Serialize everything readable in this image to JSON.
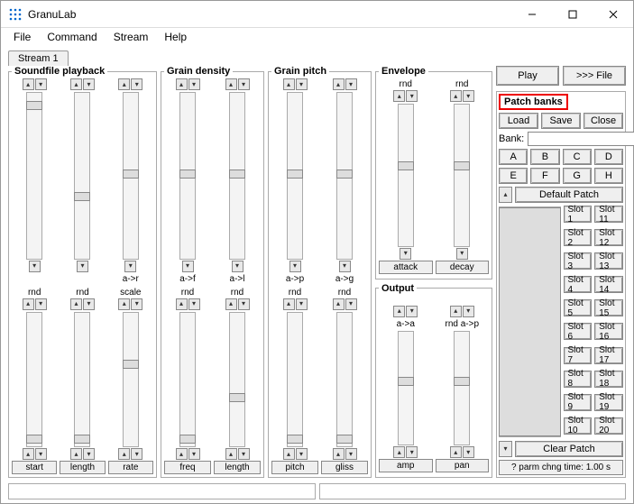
{
  "window": {
    "title": "GranuLab"
  },
  "menu": [
    "File",
    "Command",
    "Stream",
    "Help"
  ],
  "tabs": [
    "Stream 1"
  ],
  "topButtons": {
    "play": "Play",
    "file": ">>> File"
  },
  "panels": {
    "soundfile": {
      "title": "Soundfile playback",
      "upper": [
        {
          "label": ""
        },
        {
          "label": ""
        },
        {
          "label": "a->r"
        }
      ],
      "lower": [
        {
          "top": "rnd",
          "label": "start"
        },
        {
          "top": "rnd",
          "label": "length"
        },
        {
          "top": "scale",
          "label": "rate"
        }
      ]
    },
    "grainDensity": {
      "title": "Grain density",
      "upper": [
        {
          "label": "a->f"
        },
        {
          "label": "a->l"
        }
      ],
      "lower": [
        {
          "top": "rnd",
          "label": "freq"
        },
        {
          "top": "rnd",
          "label": "length"
        }
      ]
    },
    "grainPitch": {
      "title": "Grain pitch",
      "upper": [
        {
          "label": "a->p"
        },
        {
          "label": "a->g"
        }
      ],
      "lower": [
        {
          "top": "rnd",
          "label": "pitch"
        },
        {
          "top": "rnd",
          "label": "gliss"
        }
      ]
    },
    "envelope": {
      "title": "Envelope",
      "cols": [
        {
          "top": "rnd",
          "label": "attack"
        },
        {
          "top": "rnd",
          "label": "decay"
        }
      ]
    },
    "output": {
      "title": "Output",
      "cols": [
        {
          "top": "a->a",
          "label": "amp"
        },
        {
          "top": "rnd a->p",
          "label": "pan"
        }
      ]
    }
  },
  "patchBanks": {
    "title": "Patch banks",
    "buttons": {
      "load": "Load",
      "save": "Save",
      "close": "Close"
    },
    "bankLabel": "Bank:",
    "bankValue": "",
    "letters": [
      "A",
      "B",
      "C",
      "D",
      "E",
      "F",
      "G",
      "H"
    ],
    "defaultPatch": "Default Patch",
    "slots": [
      "Slot 1",
      "Slot 2",
      "Slot 3",
      "Slot 4",
      "Slot 5",
      "Slot 6",
      "Slot 7",
      "Slot 8",
      "Slot 9",
      "Slot 10",
      "Slot 11",
      "Slot 12",
      "Slot 13",
      "Slot 14",
      "Slot 15",
      "Slot 16",
      "Slot 17",
      "Slot 18",
      "Slot 19",
      "Slot 20"
    ],
    "clearPatch": "Clear Patch",
    "parmChange": "? parm chng time: 1.00 s"
  }
}
